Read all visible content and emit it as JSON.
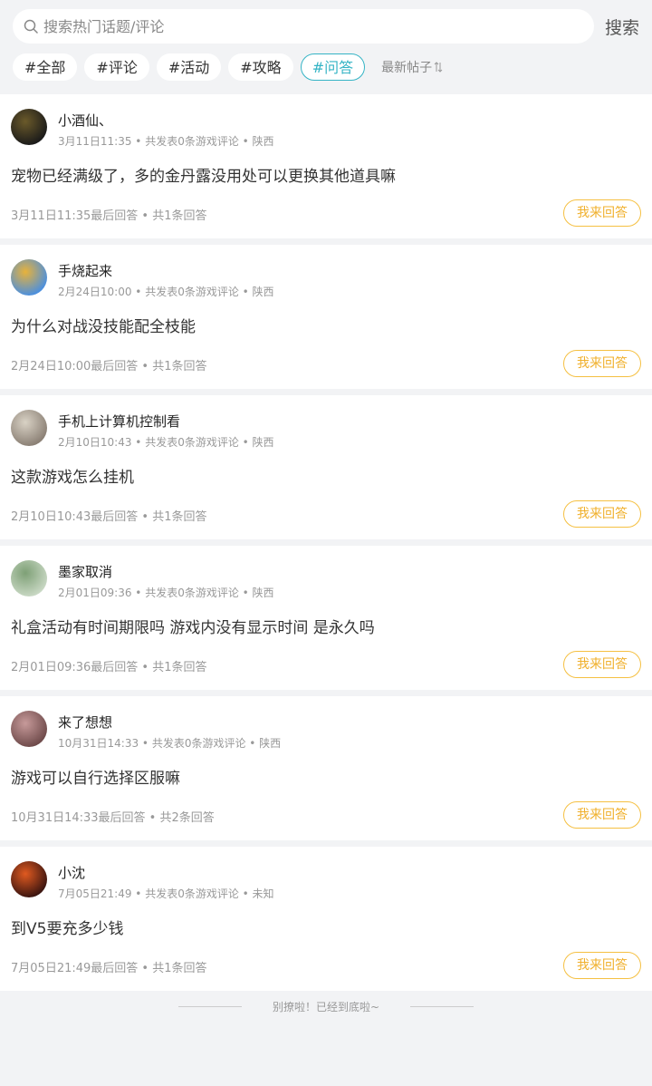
{
  "search": {
    "placeholder": "搜索热门话题/评论",
    "button_label": "搜索"
  },
  "tags": [
    {
      "label": "#全部",
      "active": false
    },
    {
      "label": "#评论",
      "active": false
    },
    {
      "label": "#活动",
      "active": false
    },
    {
      "label": "#攻略",
      "active": false
    },
    {
      "label": "#问答",
      "active": true
    }
  ],
  "sort_label": "最新帖子",
  "posts": [
    {
      "user": "小酒仙、",
      "meta": "3月11日11:35 • 共发表0条游戏评论 • 陕西",
      "title": "宠物已经满级了，多的金丹露没用处可以更换其他道具嘛",
      "footer": "3月11日11:35最后回答 • 共1条回答",
      "reply_label": "我来回答",
      "avatar_colors": [
        "#1a1a1a",
        "#6b5a2a"
      ]
    },
    {
      "user": "手烧起来",
      "meta": "2月24日10:00 • 共发表0条游戏评论 • 陕西",
      "title": "为什么对战没技能配全枝能",
      "footer": "2月24日10:00最后回答 • 共1条回答",
      "reply_label": "我来回答",
      "avatar_colors": [
        "#4a8fe0",
        "#e8b23a"
      ]
    },
    {
      "user": "手机上计算机控制看",
      "meta": "2月10日10:43 • 共发表0条游戏评论 • 陕西",
      "title": "这款游戏怎么挂机",
      "footer": "2月10日10:43最后回答 • 共1条回答",
      "reply_label": "我来回答",
      "avatar_colors": [
        "#8a7f74",
        "#d9d2c5"
      ]
    },
    {
      "user": "墨家取消",
      "meta": "2月01日09:36 • 共发表0条游戏评论 • 陕西",
      "title": "礼盒活动有时间期限吗 游戏内没有显示时间 是永久吗",
      "footer": "2月01日09:36最后回答 • 共1条回答",
      "reply_label": "我来回答",
      "avatar_colors": [
        "#c9d8c4",
        "#7ea076"
      ]
    },
    {
      "user": "来了想想",
      "meta": "10月31日14:33 • 共发表0条游戏评论 • 陕西",
      "title": "游戏可以自行选择区服嘛",
      "footer": "10月31日14:33最后回答 • 共2条回答",
      "reply_label": "我来回答",
      "avatar_colors": [
        "#6e4a4a",
        "#c79a9a"
      ]
    },
    {
      "user": "小沈",
      "meta": "7月05日21:49 • 共发表0条游戏评论 • 未知",
      "title": "到Ⅴ5要充多少钱",
      "footer": "7月05日21:49最后回答 • 共1条回答",
      "reply_label": "我来回答",
      "avatar_colors": [
        "#3a1410",
        "#e05a20"
      ]
    }
  ],
  "end_text": "别撩啦！已经到底啦~"
}
